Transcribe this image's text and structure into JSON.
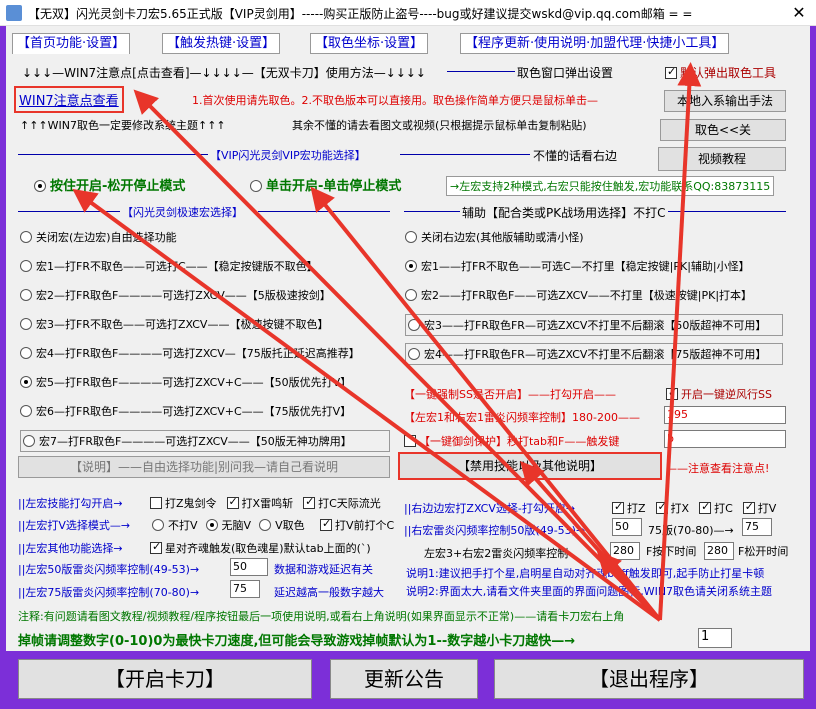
{
  "window": {
    "title": "【无双】闪光灵剑卡刀宏5.65正式版【VIP灵剑用】-----购买正版防止盗号----bug或好建议提交wskd@vip.qq.com邮箱 = =",
    "close_glyph": "✕"
  },
  "tabs": [
    "【首页功能·设置】",
    "【触发热键·设置】",
    "【取色坐标·设置】",
    "【程序更新·使用说明·加盟代理·快捷小工具】"
  ],
  "header": {
    "row1_left": "↓↓↓—WIN7注意点[点击查看]—↓↓↓↓—【无双卡刀】使用方法—↓↓↓↓",
    "row1_right_label": "取色窗口弹出设置",
    "default_popup_checkbox": "默认弹出取色工具",
    "win7_link": "WIN7注意点查看",
    "first_use_note": "1.首次使用请先取色。2.不取色版本可以直接用。取色操作简单方便只是鼠标单击—",
    "export_btn": "本地入系输出手法",
    "row3_left": "↑↑↑WIN7取色一定要修改系统主题↑↑↑",
    "row3_mid": "其余不懂的请去看图文或视频(只根据提示鼠标单击复制粘贴)",
    "color_btn": "取色<<关",
    "vip_section": "【VIP闪光灵剑VIP宏功能选择】",
    "dont_understand": "不懂的话看右边",
    "video_btn": "视频教程",
    "mode_hold": "按住开启-松开停止模式",
    "mode_click": "单击开启-单击停止模式",
    "mode_note": "→左宏支持2种模式,右宏只能按住触发,宏功能联系QQ:83873115"
  },
  "left_section": {
    "title": "【闪光灵剑极速宏选择】",
    "options": [
      {
        "text": "关闭宏(左边宏)自由选择功能",
        "selected": false
      },
      {
        "text": "宏1—打FR不取色——可选打C——【稳定按键版不取色】",
        "selected": false
      },
      {
        "text": "宏2—打FR取色F————可选打ZXCV——【5版极速按剑】",
        "selected": false
      },
      {
        "text": "宏3—打FR不取色——可选打ZXCV——【极速按键不取色】",
        "selected": false
      },
      {
        "text": "宏4—打FR取色F————可选打ZXCV—【75版托正延迟高推荐】",
        "selected": false
      },
      {
        "text": "宏5—打FR取色F————可选打ZXCV+C——【50版优先打V】",
        "selected": true
      },
      {
        "text": "宏6—打FR取色F————可选打ZXCV+C——【75版优先打V】",
        "selected": false
      },
      {
        "text": "宏7—打FR取色F————可选打ZXCV——【50版无神功牌用】",
        "selected": false
      }
    ],
    "explain_btn": "【说明】——自由选择功能|别问我—请自己看说明"
  },
  "right_section": {
    "title": "辅助【配合类或PK战场用选择】不打C",
    "options": [
      {
        "text": "关闭右边宏(其他版辅助或清小怪)",
        "selected": false
      },
      {
        "text": "宏1——打FR不取色——可选C—不打里【稳定按键|PK|辅助|小怪】",
        "selected": true
      },
      {
        "text": "宏2——打FR取色F——可选ZXCV——不打里【极速按键|PK|打本】",
        "selected": false
      },
      {
        "text": "宏3——打FR取色FR—可选ZXCV不打里不后翻滚【50版超神不可用】",
        "selected": false
      },
      {
        "text": "宏4——打FR取色FR—可选ZXCV不打里不后翻滚【75版超神不可用】",
        "selected": false
      }
    ],
    "one_key_label": "【一键强制SS是否开启】——打勾开启——",
    "one_key_checkbox": "开启一键逆风行SS",
    "thunder_label": "【左宏1和右宏1雷炎闪频率控制】180-200——",
    "thunder_value": "195",
    "defense_checkbox": "【一键御剑保护】秒打tab和F——触发键",
    "defense_value": "b",
    "banned_btn": "【禁用技能以及其他说明】",
    "note_arrow": "——注意查看注意点!"
  },
  "bottom_left": {
    "row1_label": "||左宏技能打勾开启→",
    "row1_checks": [
      {
        "label": "打Z鬼剑令",
        "checked": false
      },
      {
        "label": "打X雷鸣斩",
        "checked": true
      },
      {
        "label": "打C天际流光",
        "checked": true
      }
    ],
    "row2_label": "||左宏打V选择模式—→",
    "row2_radios": [
      {
        "label": "不打V",
        "selected": false
      },
      {
        "label": "无脑V",
        "selected": true
      },
      {
        "label": "V取色",
        "selected": false
      }
    ],
    "row2_check": "打V前打个C",
    "row3_label": "||左宏其他功能选择→",
    "row3_check": "星对齐魂触发(取色魂星)默认tab上面的(`)",
    "row4_label": "||左宏50版雷炎闪频率控制(49-53)→",
    "row4_value": "50",
    "row4_note": "数据和游戏延迟有关",
    "row5_label": "||左宏75版雷炎闪频率控制(70-80)→",
    "row5_value": "75",
    "row5_note": "延迟越高一般数字越大"
  },
  "bottom_right": {
    "row1_label": "||右边边宏打ZXCV选择-打勾开启→",
    "row1_checks": [
      {
        "label": "打Z",
        "checked": true
      },
      {
        "label": "打X",
        "checked": true
      },
      {
        "label": "打C",
        "checked": true
      },
      {
        "label": "打V",
        "checked": true
      }
    ],
    "row2_label": "||右宏雷炎闪频率控制50版(49-53)→",
    "row2_value": "50",
    "row2_label2": "75版(70-80)—→",
    "row2_value2": "75",
    "row3_label": "左宏3+右宏2雷炎闪频率控制",
    "row3_value": "280",
    "row3_label2": "F按下时间",
    "row3_value2": "280",
    "row3_label3": "F松开时间",
    "note1": "说明1:建议把手打个星,启明星自动对齐魂buff触发即可,起手防止打星卡顿",
    "note2": "说明2:界面太大,请看文件夹里面的界面问题图标,WIN7取色请关闭系统主题"
  },
  "footer": {
    "note": "注释:有问题请看图文教程/视频教程/程序按钮最后一项使用说明,或看右上角说明(如果界面显示不正常)——请看卡刀宏右上角",
    "frame_note": "掉帧请调整数字(0-10)0为最快卡刀速度,但可能会导致游戏掉帧默认为1--数字越小卡刀越快—→",
    "frame_value": "1",
    "start_btn": "【开启卡刀】",
    "notice_btn": "更新公告",
    "exit_btn": "【退出程序】"
  },
  "colors": {
    "frame": "#7c2fd8",
    "arrow": "#e8352a",
    "blue_text": "#0000cc"
  }
}
